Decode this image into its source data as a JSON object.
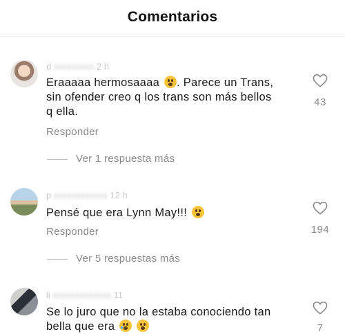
{
  "header": {
    "title": "Comentarios"
  },
  "comments": [
    {
      "meta_visible": "d",
      "meta_time": "2 h",
      "text_lines": [
        "Eraaaaa hermosaaaa",
        ". Parece un Trans,",
        "sin ofender creo q los trans son más bellos",
        "q ella."
      ],
      "reply_label": "Responder",
      "likes": "43",
      "more_replies": "Ver 1 respuesta más"
    },
    {
      "meta_visible": "p",
      "meta_time": "12 h",
      "text": "Pensé que era Lynn May!!!",
      "reply_label": "Responder",
      "likes": "194",
      "more_replies": "Ver 5 respuestas más"
    },
    {
      "meta_visible": "li",
      "meta_time": "11",
      "text_lines": [
        "Se lo juro que no la estaba conociendo tan",
        "bella que era"
      ],
      "likes": "7"
    }
  ],
  "colors": {
    "secondary_text": "#8a8a8a",
    "primary_text": "#1a1a1a",
    "emoji": "#f7c33a"
  }
}
